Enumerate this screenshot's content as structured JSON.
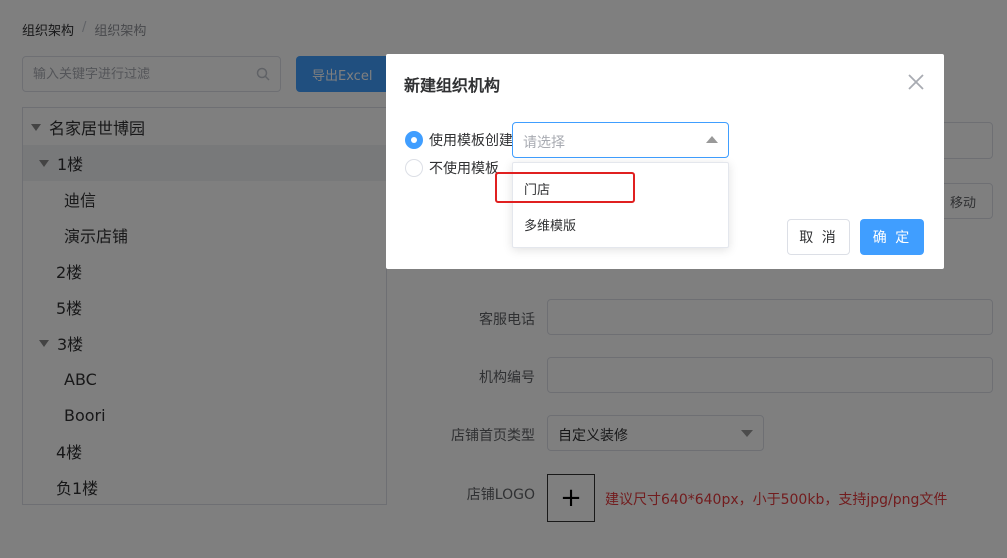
{
  "breadcrumb": {
    "root": "组织架构",
    "separator": "/",
    "current": "组织架构"
  },
  "filter": {
    "placeholder": "输入关键字进行过滤"
  },
  "toolbar": {
    "export_label": "导出Excel"
  },
  "tree": [
    {
      "label": "名家居世博园",
      "level": 0,
      "expanded": true
    },
    {
      "label": "1楼",
      "level": 1,
      "expanded": true,
      "selected": true
    },
    {
      "label": "迪信",
      "level": 2
    },
    {
      "label": "演示店铺",
      "level": 2
    },
    {
      "label": "2楼",
      "level": 1
    },
    {
      "label": "5楼",
      "level": 1
    },
    {
      "label": "3楼",
      "level": 1,
      "expanded": true
    },
    {
      "label": "ABC",
      "level": 2
    },
    {
      "label": "Boori",
      "level": 2
    },
    {
      "label": "4楼",
      "level": 1
    },
    {
      "label": "负1楼",
      "level": 1
    }
  ],
  "form": {
    "move_label": "移动",
    "phone_label": "客服电话",
    "code_label": "机构编号",
    "homepage_type_label": "店铺首页类型",
    "homepage_type_value": "自定义装修",
    "logo_label": "店铺LOGO",
    "upload_plus": "+",
    "logo_hint": "建议尺寸640*640px，小于500kb，支持jpg/png文件"
  },
  "dialog": {
    "title": "新建组织机构",
    "use_template_label": "使用模板创建",
    "no_template_label": "不使用模板",
    "template_placeholder": "请选择",
    "options": [
      "门店",
      "多维模版"
    ],
    "cancel_label": "取 消",
    "confirm_label": "确 定"
  },
  "colors": {
    "primary": "#409eff",
    "highlight": "#e02020",
    "hint": "#e4393c"
  }
}
